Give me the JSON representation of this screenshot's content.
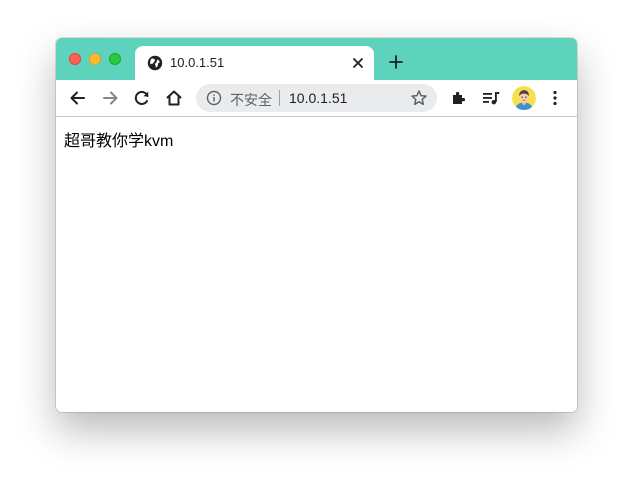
{
  "tab": {
    "title": "10.0.1.51",
    "favicon": "globe-icon"
  },
  "toolbar": {
    "back": "back-arrow-icon",
    "forward": "forward-arrow-icon",
    "reload": "reload-icon",
    "home": "home-icon",
    "extensions": "puzzle-icon",
    "media": "media-queue-icon",
    "menu": "more-vert-icon"
  },
  "omnibox": {
    "security_label": "不安全",
    "url": "10.0.1.51"
  },
  "page": {
    "body_text": "超哥教你学kvm"
  },
  "colors": {
    "titlebar": "#5dd3bc",
    "omnibox": "#e9ebec"
  }
}
